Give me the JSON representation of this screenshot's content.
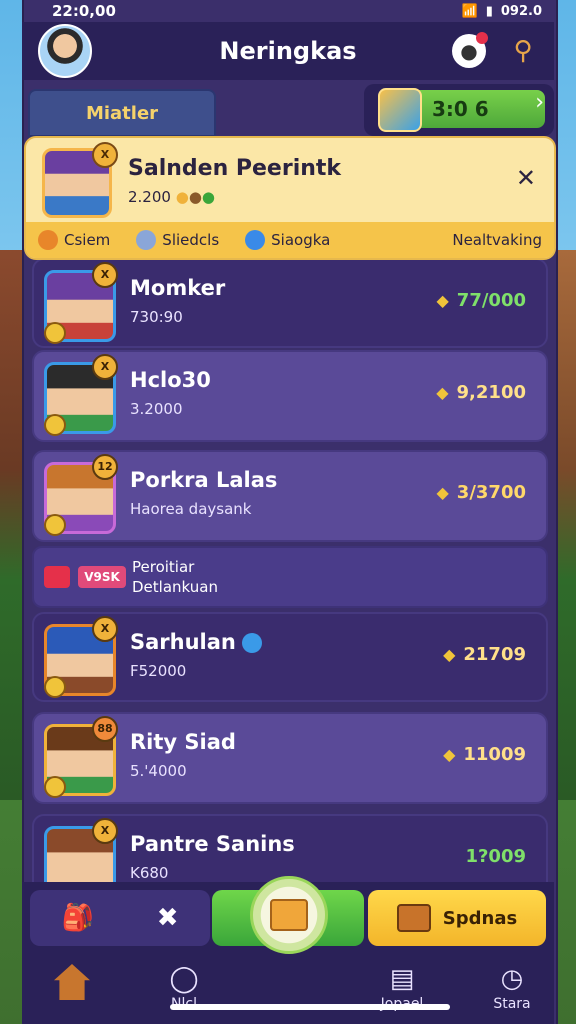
{
  "status_bar": {
    "time": "22:0,00",
    "right_text": "092.0"
  },
  "header": {
    "title": "Neringkas"
  },
  "tab_pill": {
    "label": "Miatler"
  },
  "coin_box": {
    "value": "3:0 6"
  },
  "featured": {
    "name": "Salnden Peerintk",
    "sub": "2.200",
    "rank": "X",
    "bottom": [
      {
        "label": "Csiem",
        "color": "#e8862a"
      },
      {
        "label": "Sliedcls",
        "color": "#8aa6d8"
      },
      {
        "label": "Siaogka",
        "color": "#3a8ae8"
      }
    ],
    "bottom_right": "Nealtvaking"
  },
  "players": [
    {
      "name": "Momker",
      "sub": "730:90",
      "score": "77/000",
      "badge": "X"
    },
    {
      "name": "Hclo30",
      "sub": "3.2000",
      "score": "9,2100",
      "badge": "X"
    },
    {
      "name": "Porkra Lalas",
      "sub": "Haorea daysank",
      "score": "3/3700",
      "badge": "12"
    }
  ],
  "notification": {
    "badge": "V9SK",
    "line1": "Peroitiar",
    "line2": "Detlankuan"
  },
  "players2": [
    {
      "name": "Sarhulan",
      "sub": "F52000",
      "score": "21709",
      "badge": "X"
    },
    {
      "name": "Rity Siad",
      "sub": "5.'4000",
      "score": "11009",
      "badge": "88"
    },
    {
      "name": "Pantre Sanins",
      "sub": "K680",
      "score": "1?009",
      "badge": "X"
    }
  ],
  "action_bar": {
    "yellow_label": "Spdnas"
  },
  "tabbar": [
    {
      "label": ""
    },
    {
      "label": "Nlcl"
    },
    {
      "label": "Jopael"
    },
    {
      "label": "Stara"
    }
  ],
  "colors": {
    "panel": "#3b2f6b",
    "accent_green": "#7fe06a",
    "gold": "#f0c43a"
  }
}
